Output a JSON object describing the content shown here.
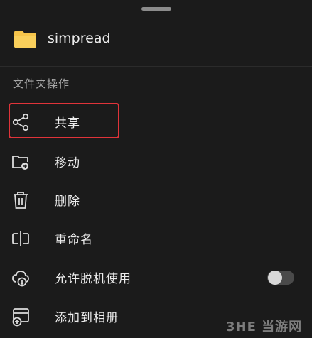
{
  "folder": {
    "name": "simpread",
    "icon": "folder-icon"
  },
  "section": {
    "title": "文件夹操作"
  },
  "items": [
    {
      "label": "共享",
      "icon": "share-icon"
    },
    {
      "label": "移动",
      "icon": "move-folder-icon"
    },
    {
      "label": "删除",
      "icon": "trash-icon"
    },
    {
      "label": "重命名",
      "icon": "rename-icon"
    },
    {
      "label": "允许脱机使用",
      "icon": "cloud-download-icon",
      "toggle": false
    },
    {
      "label": "添加到相册",
      "icon": "add-album-icon"
    }
  ],
  "watermark": {
    "text": "3HE 当游网"
  },
  "colors": {
    "background": "#1b1b1b",
    "highlight": "#e0343a",
    "folder": "#f6c44a"
  }
}
